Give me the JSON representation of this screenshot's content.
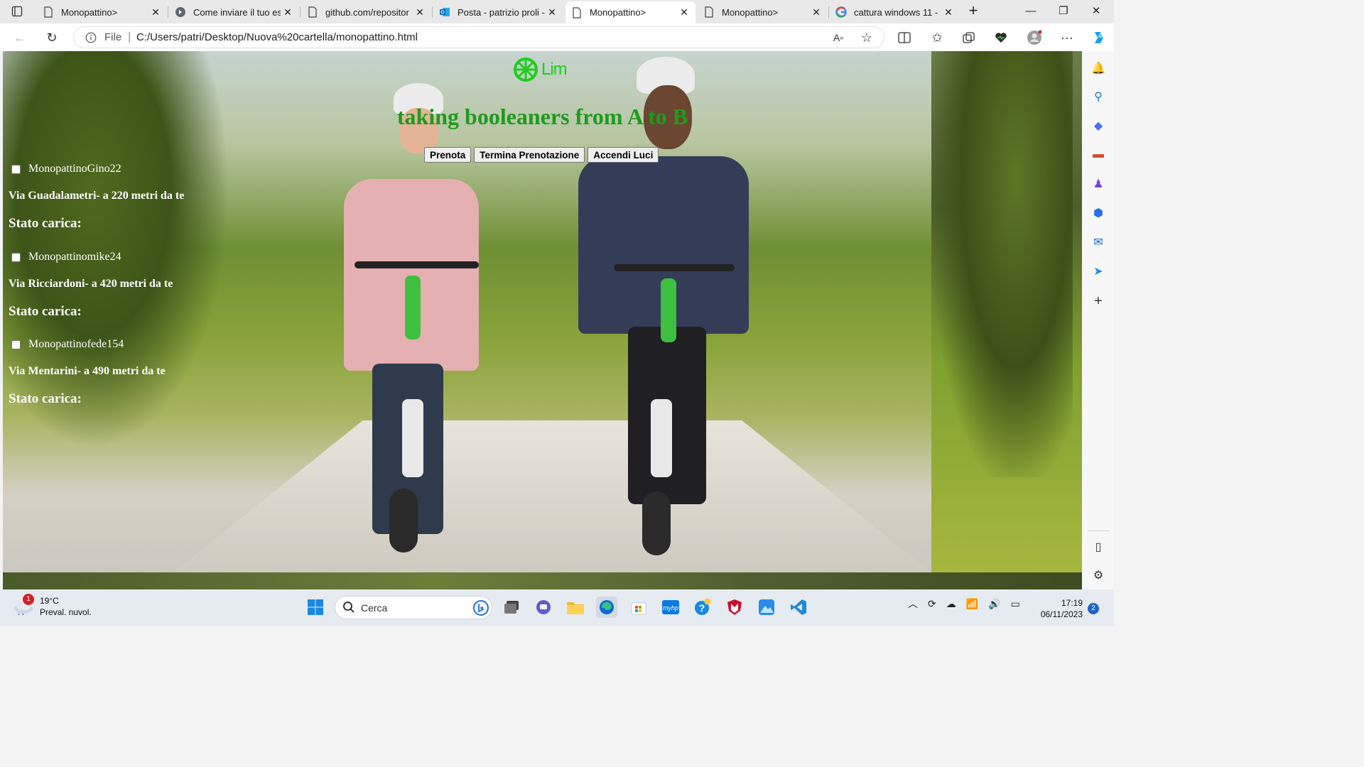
{
  "browser": {
    "tabs": [
      {
        "title": "Monopattino>",
        "icon": "page-icon"
      },
      {
        "title": "Come inviare il tuo es",
        "icon": "gear-favicon-icon"
      },
      {
        "title": "github.com/repositor",
        "icon": "page-icon"
      },
      {
        "title": "Posta - patrizio proli -",
        "icon": "outlook-icon"
      },
      {
        "title": "Monopattino>",
        "icon": "page-icon",
        "active": true
      },
      {
        "title": "Monopattino>",
        "icon": "page-icon"
      },
      {
        "title": "cattura windows 11 -",
        "icon": "google-icon"
      }
    ],
    "address": {
      "scheme": "File",
      "url": "C:/Users/patri/Desktop/Nuova%20cartella/monopattino.html"
    }
  },
  "page": {
    "logo_text": "Lim",
    "headline": "taking booleaners from A to B",
    "buttons": {
      "book": "Prenota",
      "end_booking": "Termina Prenotazione",
      "lights_on": "Accendi Luci"
    },
    "scooters": [
      {
        "name": "MonopattinoGino22",
        "address": "Via Guadalametri- a 220 metri da te",
        "charge_label": "Stato carica:"
      },
      {
        "name": "Monopattinomike24",
        "address": "Via Ricciardoni- a 420 metri da te",
        "charge_label": "Stato carica:"
      },
      {
        "name": "Monopattinofede154",
        "address": "Via Mentarini- a 490 metri da te",
        "charge_label": "Stato carica:"
      }
    ]
  },
  "taskbar": {
    "weather": {
      "temp": "19°C",
      "desc": "Preval. nuvol.",
      "badge": "1"
    },
    "search_placeholder": "Cerca",
    "time": "17:19",
    "date": "06/11/2023",
    "notifications": "2"
  },
  "colors": {
    "accent_green": "#1e9b1e",
    "logo_green": "#1bcf1b",
    "edge_blue": "#0c6ad9"
  }
}
